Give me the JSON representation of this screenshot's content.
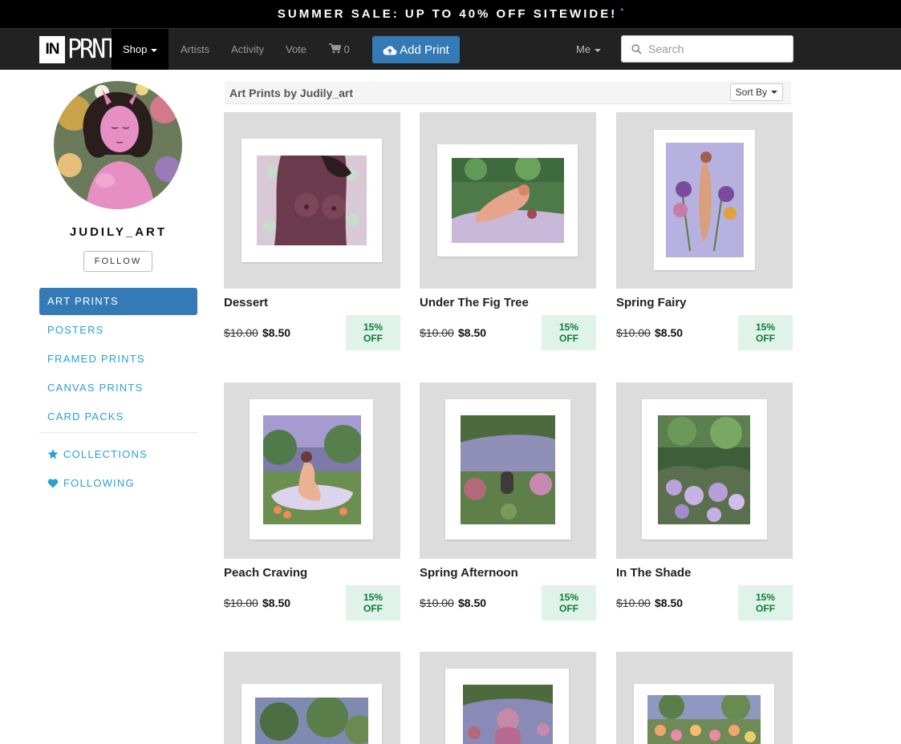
{
  "promo": {
    "text": "SUMMER SALE: UP TO 40% OFF SITEWIDE!",
    "marker": "*"
  },
  "nav": {
    "logo_in": "IN",
    "logo_prnt": "PRNT",
    "shop": "Shop",
    "artists": "Artists",
    "activity": "Activity",
    "vote": "Vote",
    "cart_count": "0",
    "add_print": "Add Print",
    "me": "Me",
    "search_placeholder": "Search"
  },
  "profile": {
    "username": "JUDILY_ART",
    "follow": "FOLLOW"
  },
  "sidebar": {
    "items": [
      {
        "label": "ART PRINTS",
        "active": true
      },
      {
        "label": "POSTERS"
      },
      {
        "label": "FRAMED PRINTS"
      },
      {
        "label": "CANVAS PRINTS"
      },
      {
        "label": "CARD PACKS"
      }
    ],
    "collections": "COLLECTIONS",
    "following": "FOLLOWING"
  },
  "main": {
    "title": "Art Prints by Judily_art",
    "sort": "Sort By"
  },
  "prints": [
    {
      "title": "Dessert",
      "old_price": "$10.00",
      "price": "$8.50",
      "badge_pct": "15%",
      "badge_off": "OFF"
    },
    {
      "title": "Under The Fig Tree",
      "old_price": "$10.00",
      "price": "$8.50",
      "badge_pct": "15%",
      "badge_off": "OFF"
    },
    {
      "title": "Spring Fairy",
      "old_price": "$10.00",
      "price": "$8.50",
      "badge_pct": "15%",
      "badge_off": "OFF"
    },
    {
      "title": "Peach Craving",
      "old_price": "$10.00",
      "price": "$8.50",
      "badge_pct": "15%",
      "badge_off": "OFF"
    },
    {
      "title": "Spring Afternoon",
      "old_price": "$10.00",
      "price": "$8.50",
      "badge_pct": "15%",
      "badge_off": "OFF"
    },
    {
      "title": "In The Shade",
      "old_price": "$10.00",
      "price": "$8.50",
      "badge_pct": "15%",
      "badge_off": "OFF"
    }
  ],
  "colors": {
    "accent": "#337ab7",
    "link": "#2aa0d4",
    "badge_bg": "#dff3e8",
    "badge_text": "#0e7a3a",
    "navbar": "#222222"
  }
}
